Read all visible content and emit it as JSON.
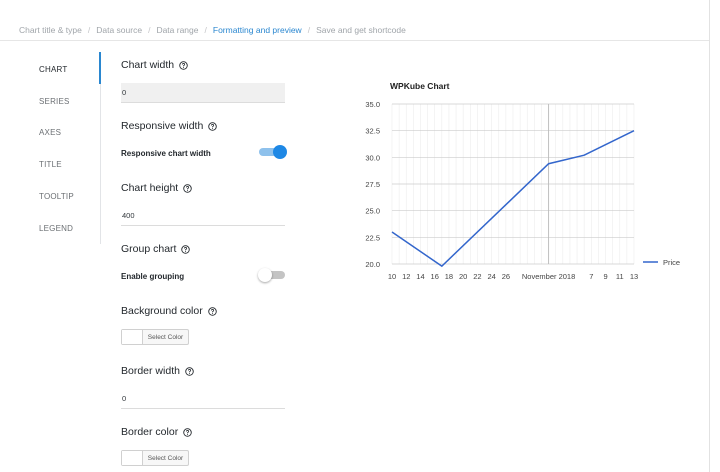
{
  "breadcrumb": [
    {
      "label": "Chart title & type",
      "active": false
    },
    {
      "label": "Data source",
      "active": false
    },
    {
      "label": "Data range",
      "active": false
    },
    {
      "label": "Formatting and preview",
      "active": true
    },
    {
      "label": "Save and get shortcode",
      "active": false
    }
  ],
  "breadcrumb_separator": "/",
  "tabs": [
    {
      "label": "CHART",
      "active": true
    },
    {
      "label": "SERIES",
      "active": false
    },
    {
      "label": "AXES",
      "active": false
    },
    {
      "label": "TITLE",
      "active": false
    },
    {
      "label": "TOOLTIP",
      "active": false
    },
    {
      "label": "LEGEND",
      "active": false
    }
  ],
  "settings": {
    "chart_width": {
      "title": "Chart width",
      "value": "0"
    },
    "responsive_width": {
      "title": "Responsive width",
      "option_label": "Responsive chart width",
      "enabled": true
    },
    "chart_height": {
      "title": "Chart height",
      "value": "400"
    },
    "group_chart": {
      "title": "Group chart",
      "option_label": "Enable grouping",
      "enabled": false
    },
    "background_color": {
      "title": "Background color",
      "button_label": "Select Color"
    },
    "border_width": {
      "title": "Border width",
      "value": "0"
    },
    "border_color": {
      "title": "Border color",
      "button_label": "Select Color"
    }
  },
  "colors": {
    "accent": "#2a87d0",
    "toggle_on": "#1e88e5",
    "series_line": "#3366cc"
  },
  "chart_data": {
    "type": "line",
    "title": "WPKube Chart",
    "xlabel": "",
    "ylabel": "",
    "x_tick_labels": [
      "10",
      "12",
      "14",
      "16",
      "18",
      "20",
      "22",
      "24",
      "26",
      "November 2018",
      "7",
      "9",
      "11",
      "13"
    ],
    "x_month_boundary_label": "November 2018",
    "ylim": [
      20,
      35
    ],
    "y_ticks": [
      "35.0",
      "32.5",
      "30.0",
      "27.5",
      "25.0",
      "22.5",
      "20.0"
    ],
    "series": [
      {
        "name": "Price",
        "x": [
          "Oct 10",
          "Oct 17",
          "Nov 1",
          "Nov 6",
          "Nov 13"
        ],
        "values": [
          23.0,
          19.8,
          29.4,
          30.2,
          32.5
        ]
      }
    ],
    "legend": "right",
    "grid": true
  }
}
